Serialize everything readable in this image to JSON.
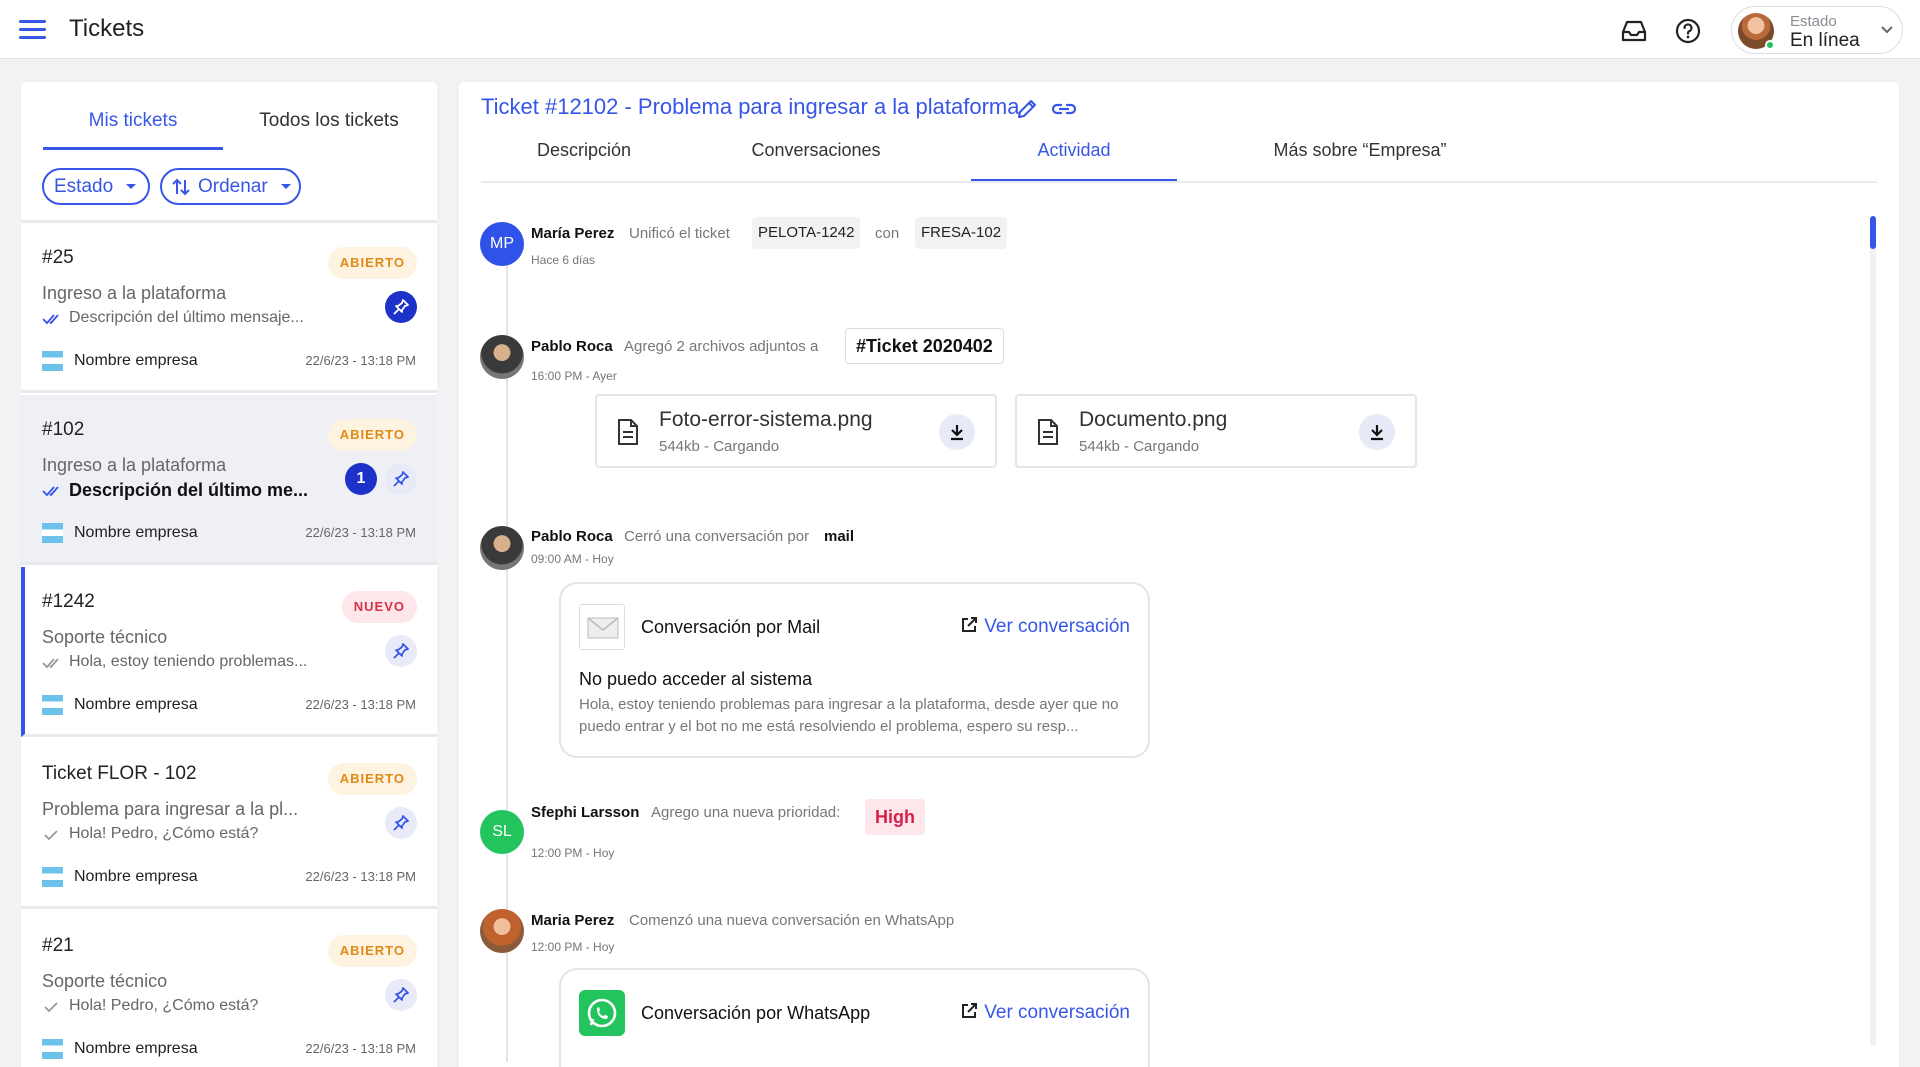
{
  "header": {
    "title": "Tickets",
    "status_label": "Estado",
    "status_value": "En línea"
  },
  "left": {
    "tabs": [
      "Mis tickets",
      "Todos los tickets"
    ],
    "filters": [
      "Estado",
      "Ordenar"
    ],
    "tickets": [
      {
        "id": "#25",
        "badge": "ABIERTO",
        "subject": "Ingreso a la plataforma",
        "message": "Descripción del último mensaje...",
        "company": "Nombre empresa",
        "date": "22/6/23 - 13:18 PM",
        "unread": ""
      },
      {
        "id": "#102",
        "badge": "ABIERTO",
        "subject": "Ingreso a la plataforma",
        "message": "Descripción del último me...",
        "company": "Nombre empresa",
        "date": "22/6/23 - 13:18 PM",
        "unread": "1"
      },
      {
        "id": "#1242",
        "badge": "NUEVO",
        "subject": "Soporte técnico",
        "message": "Hola, estoy teniendo problemas...",
        "company": "Nombre empresa",
        "date": "22/6/23 - 13:18 PM",
        "unread": ""
      },
      {
        "id": "Ticket FLOR - 102",
        "badge": "ABIERTO",
        "subject": "Problema para ingresar a la pl...",
        "message": "Hola! Pedro, ¿Cómo está?",
        "company": "Nombre empresa",
        "date": "22/6/23 - 13:18 PM",
        "unread": ""
      },
      {
        "id": "#21",
        "badge": "ABIERTO",
        "subject": "Soporte técnico",
        "message": "Hola! Pedro, ¿Cómo está?",
        "company": "Nombre empresa",
        "date": "22/6/23 - 13:18 PM",
        "unread": ""
      }
    ]
  },
  "ticket": {
    "title": "Ticket #12102 - Problema para ingresar a la plataforma",
    "tabs": [
      "Descripción",
      "Conversaciones",
      "Actividad",
      "Más sobre “Empresa”"
    ]
  },
  "activity": {
    "e1": {
      "initials": "MP",
      "name": "María Perez",
      "action": "Unificó el ticket",
      "chip1": "PELOTA-1242",
      "connector": "con",
      "chip2": "FRESA-102",
      "time": "Hace 6 días"
    },
    "e2": {
      "name": "Pablo Roca",
      "action": "Agregó 2 archivos adjuntos a",
      "ticket_ref": "#Ticket 2020402",
      "time": "16:00 PM - Ayer",
      "files": [
        {
          "name": "Foto-error-sistema.png",
          "meta": "544kb - Cargando"
        },
        {
          "name": "Documento.png",
          "meta": "544kb - Cargando"
        }
      ]
    },
    "e3": {
      "name": "Pablo Roca",
      "action": "Cerró una conversación por",
      "channel": "mail",
      "time": "09:00 AM - Hoy",
      "card": {
        "title": "Conversación por Mail",
        "link": "Ver conversación",
        "subject": "No puedo acceder al sistema",
        "body": "Hola, estoy teniendo problemas para ingresar a la plataforma, desde ayer que no puedo entrar y el bot no me está resolviendo el problema, espero su resp..."
      }
    },
    "e4": {
      "initials": "SL",
      "name": "Sfephi Larsson",
      "action": "Agrego una nueva prioridad:",
      "priority": "High",
      "time": "12:00 PM - Hoy"
    },
    "e5": {
      "name": "Maria Perez",
      "action": "Comenzó una nueva conversación en WhatsApp",
      "time": "12:00 PM - Hoy",
      "card": {
        "title": "Conversación por WhatsApp",
        "link": "Ver conversación"
      }
    }
  },
  "colors": {
    "accent": "#3756e8",
    "open": "#e08a16",
    "new": "#d6324a",
    "priority_high": "#d6224a",
    "whatsapp": "#23c45e"
  }
}
